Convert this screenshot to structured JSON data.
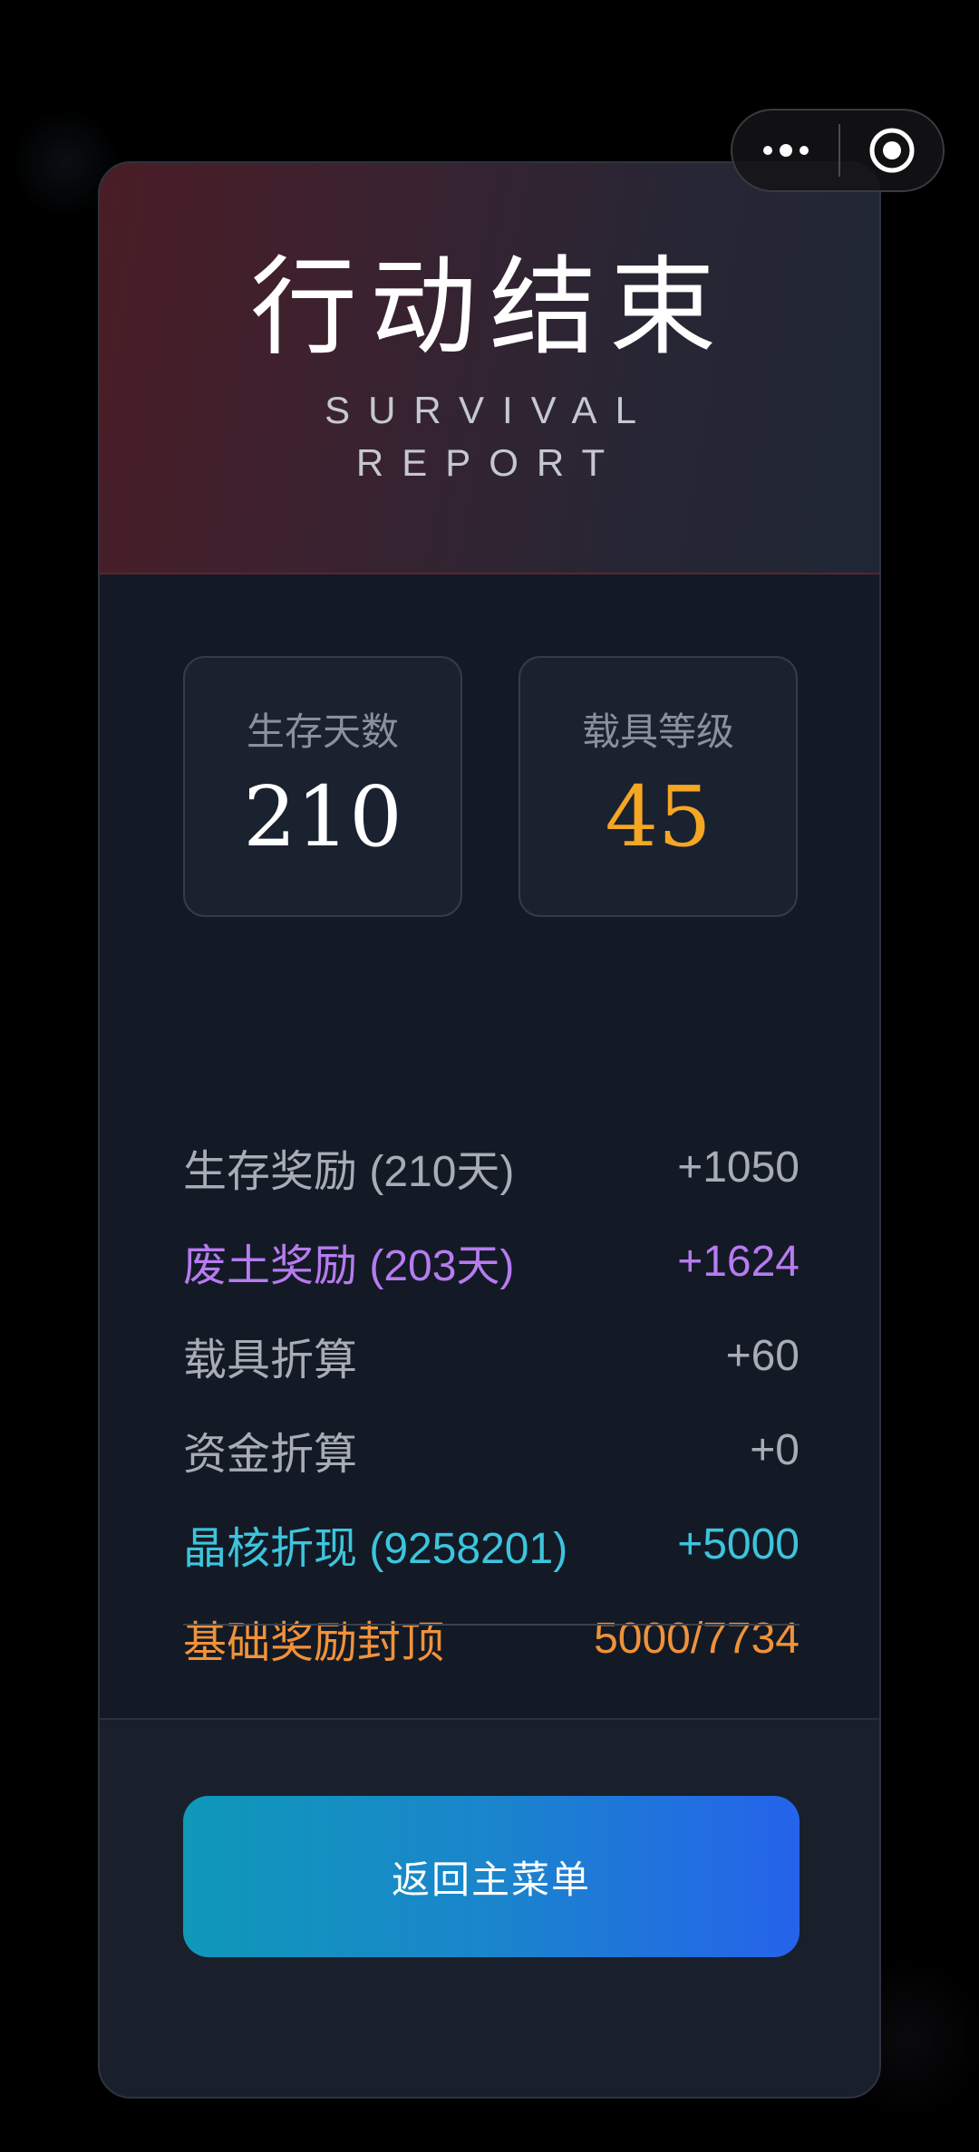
{
  "capsule": {
    "more_icon": "more-dots-icon",
    "close_icon": "target-circle-icon"
  },
  "header": {
    "title": "行动结束",
    "subtitle": "SURVIVAL REPORT"
  },
  "stats": [
    {
      "label": "生存天数",
      "value": "210",
      "color": "#ffffff"
    },
    {
      "label": "载具等级",
      "value": "45",
      "color": "#f5a623"
    }
  ],
  "rewards": [
    {
      "label": "生存奖励 (210天)",
      "value": "+1050",
      "color": "#a7acb5"
    },
    {
      "label": "废土奖励 (203天)",
      "value": "+1624",
      "color": "#b77bf0"
    },
    {
      "label": "载具折算",
      "value": "+60",
      "color": "#a7acb5"
    },
    {
      "label": "资金折算",
      "value": "+0",
      "color": "#a7acb5"
    },
    {
      "label": "晶核折现 (9258201)",
      "value": "+5000",
      "color": "#3cc5dc"
    },
    {
      "label": "基础奖励封顶",
      "value": "5000/7734",
      "color": "#f0923a"
    }
  ],
  "footer": {
    "home_button": "返回主菜单"
  }
}
